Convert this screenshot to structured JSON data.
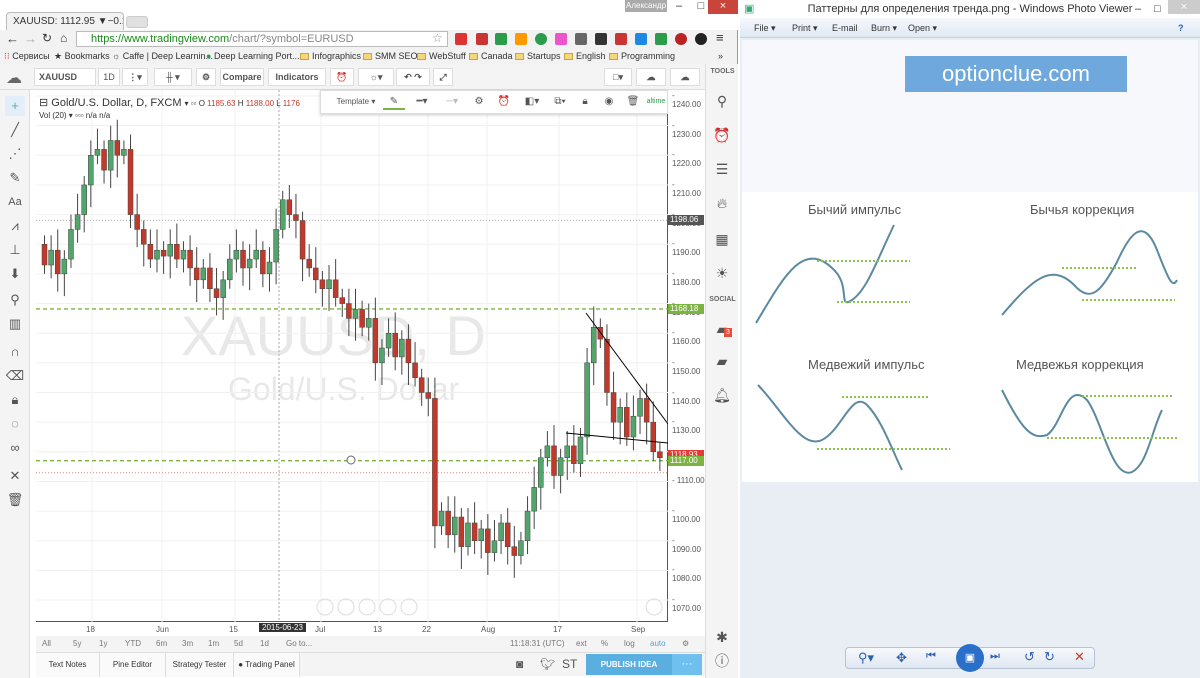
{
  "browser": {
    "tab_title": "XAUUSD: 1112.95 ▼−0.15",
    "user": "Александр",
    "url_host": "https://www.tradingview.com",
    "url_path": "/chart/?symbol=EURUSD",
    "bookmarks": [
      "Сервисы",
      "Bookmarks",
      "Caffe | Deep Learnin...",
      "Deep Learning Port...",
      "Infographics",
      "SMM SEO",
      "WebStuff",
      "Canada",
      "Startups",
      "English",
      "Programming"
    ],
    "more": "»"
  },
  "toolbar": {
    "symbol": "XAUUSD",
    "interval": "1D",
    "compare": "Compare",
    "indicators": "Indicators",
    "tools": "TOOLS",
    "social": "SOCIAL",
    "chat_badge": "3"
  },
  "legend": {
    "title": "Gold/U.S. Dollar, D, FXCM",
    "o_label": "O",
    "o": "1185.63",
    "h_label": "H",
    "h": "1188.00",
    "l_label": "L",
    "l": "1176",
    "vol": "Vol (20)",
    "vol_val": "n/a n/a",
    "realtime": "altime"
  },
  "drawbar": {
    "template": "Template"
  },
  "watermark": {
    "symbol": "XAUUSD, D",
    "name": "Gold/U.S. Dollar"
  },
  "price_axis": {
    "ticks": [
      1240,
      1230,
      1220,
      1210,
      1200,
      1190,
      1180,
      1170,
      1160,
      1150,
      1140,
      1130,
      1120,
      1110,
      1100,
      1090,
      1080,
      1070
    ],
    "labels": [
      "1240.00",
      "1230.00",
      "1220.00",
      "1210.00",
      "1200.00",
      "1190.00",
      "1180.00",
      "1170.00",
      "1160.00",
      "1150.00",
      "1140.00",
      "1130.00",
      "1120.00",
      "1110.00",
      "1100.00",
      "1090.00",
      "1080.00",
      "1070.00"
    ],
    "tags": [
      {
        "value": 1198.06,
        "text": "1198.06",
        "color": "#555555"
      },
      {
        "value": 1168.18,
        "text": "1168.18",
        "color": "#7cb342"
      },
      {
        "value": 1118.93,
        "text": "1118.93",
        "color": "#e53935"
      },
      {
        "value": 1117.0,
        "text": "1117.00",
        "color": "#7cb342"
      }
    ]
  },
  "time_axis": {
    "labels": [
      "18",
      "Jun",
      "15",
      "2015-06-23",
      "Jul",
      "13",
      "22",
      "Aug",
      "17",
      "Sep"
    ]
  },
  "chart_data": {
    "type": "candlestick",
    "ylim": [
      1065,
      1245
    ],
    "hlines": [
      1168.18,
      1117.0,
      1198.06,
      1113
    ],
    "open_first": 1190,
    "closes": [
      1183,
      1188,
      1180,
      1185,
      1195,
      1200,
      1210,
      1220,
      1222,
      1215,
      1225,
      1220,
      1222,
      1200,
      1195,
      1190,
      1185,
      1188,
      1186,
      1190,
      1185,
      1188,
      1182,
      1178,
      1182,
      1175,
      1172,
      1178,
      1185,
      1188,
      1182,
      1185,
      1188,
      1180,
      1184,
      1195,
      1205,
      1200,
      1198,
      1185,
      1182,
      1178,
      1175,
      1178,
      1172,
      1170,
      1165,
      1168,
      1162,
      1165,
      1150,
      1155,
      1160,
      1152,
      1158,
      1150,
      1145,
      1140,
      1138,
      1095,
      1100,
      1092,
      1098,
      1088,
      1096,
      1090,
      1094,
      1086,
      1090,
      1096,
      1088,
      1085,
      1090,
      1100,
      1108,
      1118,
      1122,
      1112,
      1118,
      1122,
      1116,
      1125,
      1150,
      1162,
      1158,
      1140,
      1130,
      1135,
      1125,
      1132,
      1138,
      1130,
      1120,
      1118
    ],
    "up_color": "#53a56b",
    "down_color": "#c0392b"
  },
  "range_bar": {
    "items": [
      "All",
      "5y",
      "1y",
      "YTD",
      "6m",
      "3m",
      "1m",
      "5d",
      "1d",
      "Go to..."
    ],
    "time": "11:18:31 (UTC)",
    "opts": [
      "ext",
      "%",
      "log",
      "auto"
    ]
  },
  "bottom_tabs": [
    "Text Notes",
    "Pine Editor",
    "Strategy Tester",
    "Trading Panel"
  ],
  "publish": "PUBLISH IDEA",
  "st": "ST",
  "more_dots": "···",
  "viewer": {
    "title": "Паттерны для определения тренда.png - Windows Photo Viewer",
    "menu": [
      "File",
      "Print",
      "E-mail",
      "Burn",
      "Open"
    ],
    "banner": "optionclue.com",
    "banner_color": "#6fa8dc",
    "patterns": [
      "Бычий импульс",
      "Бычья коррекция",
      "Медвежий импульс",
      "Медвежья коррекция"
    ]
  }
}
